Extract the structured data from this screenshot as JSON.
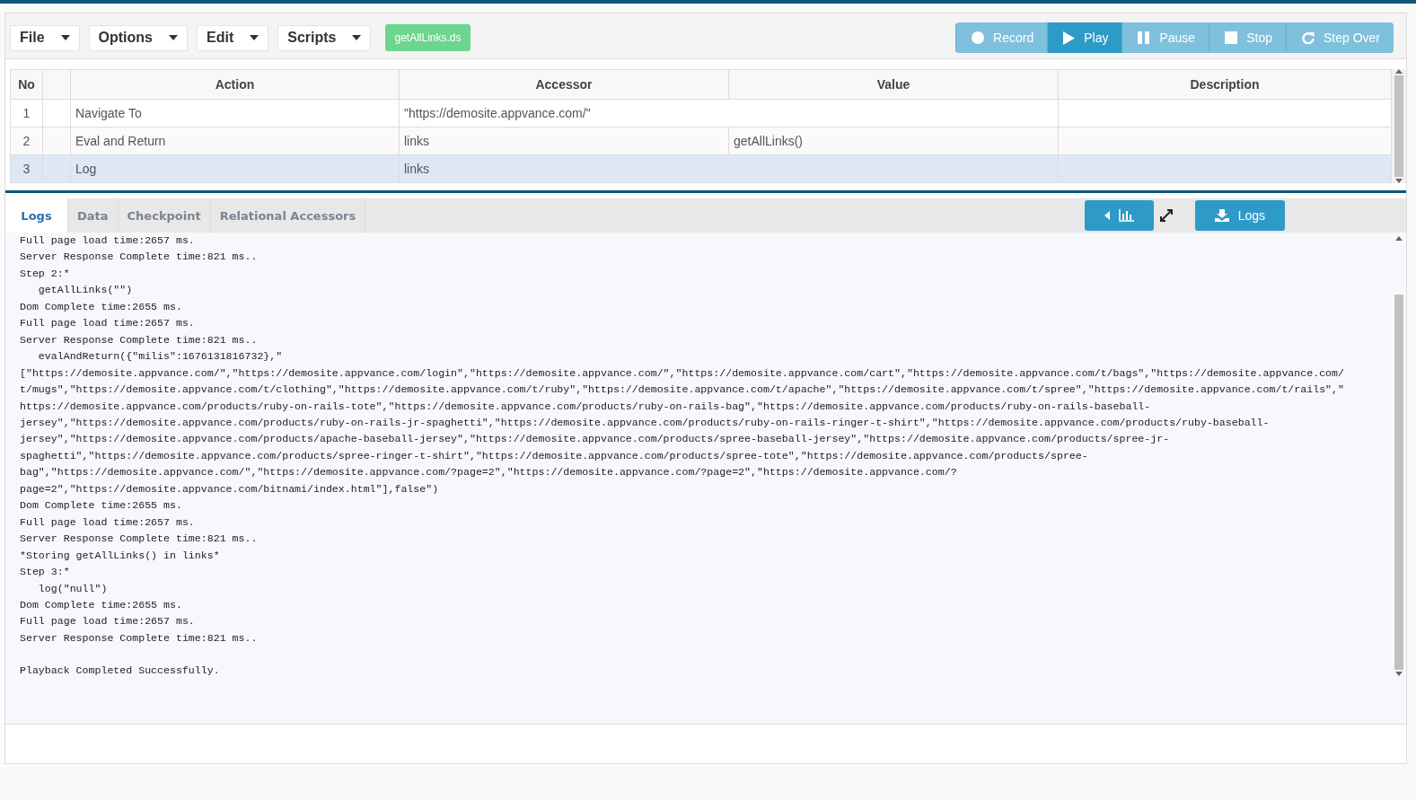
{
  "menus": [
    {
      "label": "File"
    },
    {
      "label": "Options"
    },
    {
      "label": "Edit"
    },
    {
      "label": "Scripts"
    }
  ],
  "script_badge": "getAllLinks.ds",
  "controls": [
    {
      "kind": "record",
      "label": "Record",
      "selected": false
    },
    {
      "kind": "play",
      "label": "Play",
      "selected": true
    },
    {
      "kind": "pause",
      "label": "Pause",
      "selected": false
    },
    {
      "kind": "stop",
      "label": "Stop",
      "selected": false
    },
    {
      "kind": "step",
      "label": "Step Over",
      "selected": false
    }
  ],
  "table": {
    "columns": [
      "No",
      "",
      "Action",
      "Accessor",
      "Value",
      "Description"
    ],
    "rows": [
      {
        "no": "1",
        "action": "Navigate To",
        "accessor": "\"https://demosite.appvance.com/\"",
        "value": "",
        "description": "",
        "selected": false
      },
      {
        "no": "2",
        "action": "Eval and Return",
        "accessor": "links",
        "value": "getAllLinks()",
        "description": "",
        "selected": false
      },
      {
        "no": "3",
        "action": "Log",
        "accessor": "links",
        "value": "",
        "description": "",
        "selected": true
      }
    ]
  },
  "tabs": [
    {
      "label": "Logs",
      "selected": true
    },
    {
      "label": "Data",
      "selected": false
    },
    {
      "label": "Checkpoint",
      "selected": false
    },
    {
      "label": "Relational Accessors",
      "selected": false
    }
  ],
  "logs_button": "Logs",
  "log_lines": [
    "Full page load time:2657 ms.",
    "Server Response Complete time:821 ms..",
    "Step 2:*",
    "   getAllLinks(\"\")",
    "Dom Complete time:2655 ms.",
    "Full page load time:2657 ms.",
    "Server Response Complete time:821 ms..",
    "   evalAndReturn({\"milis\":1676131816732},\"",
    "[\"https://demosite.appvance.com/\",\"https://demosite.appvance.com/login\",\"https://demosite.appvance.com/\",\"https://demosite.appvance.com/cart\",\"https://demosite.appvance.com/t/bags\",\"https://demosite.appvance.com/",
    "t/mugs\",\"https://demosite.appvance.com/t/clothing\",\"https://demosite.appvance.com/t/ruby\",\"https://demosite.appvance.com/t/apache\",\"https://demosite.appvance.com/t/spree\",\"https://demosite.appvance.com/t/rails\",\"",
    "https://demosite.appvance.com/products/ruby-on-rails-tote\",\"https://demosite.appvance.com/products/ruby-on-rails-bag\",\"https://demosite.appvance.com/products/ruby-on-rails-baseball-",
    "jersey\",\"https://demosite.appvance.com/products/ruby-on-rails-jr-spaghetti\",\"https://demosite.appvance.com/products/ruby-on-rails-ringer-t-shirt\",\"https://demosite.appvance.com/products/ruby-baseball-",
    "jersey\",\"https://demosite.appvance.com/products/apache-baseball-jersey\",\"https://demosite.appvance.com/products/spree-baseball-jersey\",\"https://demosite.appvance.com/products/spree-jr-",
    "spaghetti\",\"https://demosite.appvance.com/products/spree-ringer-t-shirt\",\"https://demosite.appvance.com/products/spree-tote\",\"https://demosite.appvance.com/products/spree-",
    "bag\",\"https://demosite.appvance.com/\",\"https://demosite.appvance.com/?page=2\",\"https://demosite.appvance.com/?page=2\",\"https://demosite.appvance.com/?",
    "page=2\",\"https://demosite.appvance.com/bitnami/index.html\"],false\")",
    "Dom Complete time:2655 ms.",
    "Full page load time:2657 ms.",
    "Server Response Complete time:821 ms..",
    "*Storing getAllLinks() in links*",
    "Step 3:*",
    "   log(\"null\")",
    "Dom Complete time:2655 ms.",
    "Full page load time:2657 ms.",
    "Server Response Complete time:821 ms.."
  ],
  "final_message": "Playback Completed Successfully."
}
